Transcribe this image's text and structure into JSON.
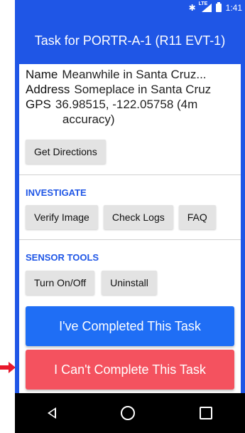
{
  "status_bar": {
    "network": "LTE",
    "time": "1:41"
  },
  "app_bar": {
    "title": "Task for PORTR-A-1 (R11 EVT-1)"
  },
  "details": {
    "name_label": "Name",
    "name_value": "Meanwhile in Santa Cruz...",
    "address_label": "Address",
    "address_value": "Someplace in Santa Cruz",
    "gps_label": "GPS",
    "gps_value_line1": "36.98515, -122.05758 (4m",
    "gps_value_line2": "accuracy)"
  },
  "buttons": {
    "directions": "Get Directions",
    "verify_image": "Verify Image",
    "check_logs": "Check Logs",
    "faq": "FAQ",
    "turn_on_off": "Turn On/Off",
    "uninstall": "Uninstall",
    "completed": "I've Completed This Task",
    "cant_complete": "I Can't Complete This Task"
  },
  "sections": {
    "investigate": "INVESTIGATE",
    "sensor_tools": "SENSOR TOOLS"
  },
  "colors": {
    "primary": "#1f56e6",
    "complete_button": "#1f6ef5",
    "cant_button": "#f4525f",
    "pointer_arrow": "#e8192c"
  },
  "icons": [
    "bluetooth-icon",
    "signal-icon",
    "battery-icon",
    "back-icon",
    "home-icon",
    "recents-icon",
    "pointer-arrow-icon"
  ]
}
